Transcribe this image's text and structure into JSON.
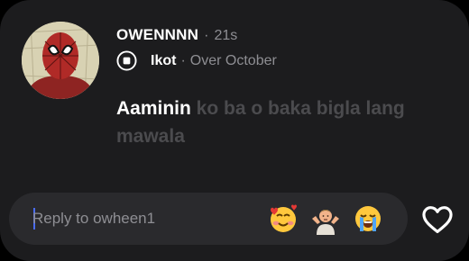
{
  "note": {
    "username": "OWENNNN",
    "separator": "·",
    "timestamp": "21s",
    "song": {
      "title": "Ikot",
      "separator": "·",
      "artist": "Over October",
      "icon": "music-note-icon"
    },
    "lyrics": {
      "highlighted": "Aaminin",
      "rest": " ko ba o baka bigla lang mawala"
    },
    "avatar": "spiderman-avatar"
  },
  "reply": {
    "placeholder": "Reply to owheen1",
    "value": ""
  },
  "reactions": [
    {
      "name": "smiling-face-with-hearts",
      "glyph": "🥰"
    },
    {
      "name": "person-shrugging",
      "glyph": "🤷"
    },
    {
      "name": "loudly-crying-face",
      "glyph": "😭"
    }
  ],
  "like_icon": "heart-outline-icon",
  "colors": {
    "card": "#1c1c1e",
    "input": "#2a2a2d",
    "muted": "#8e8e93",
    "dim_lyric": "#4b4b4e",
    "caret": "#4a6cf7"
  }
}
